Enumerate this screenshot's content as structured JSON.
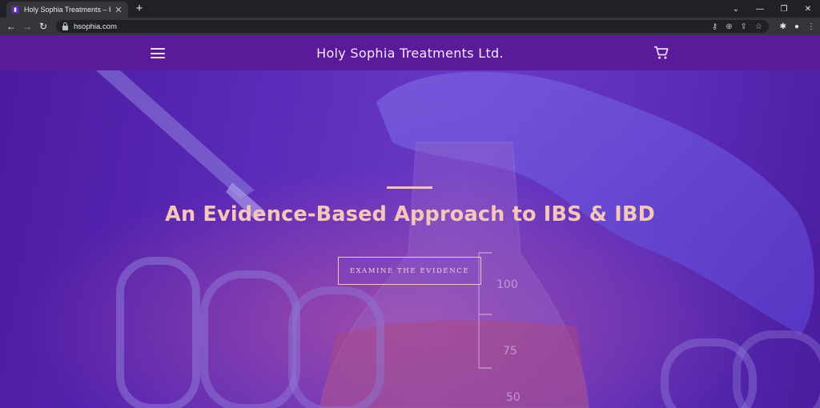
{
  "browser": {
    "tab_title": "Holy Sophia Treatments – Holy S",
    "tab_close": "✕",
    "new_tab": "+",
    "url": "hsophia.com",
    "win_minimize": "⌄",
    "win_restore": "—",
    "win_max": "❐",
    "win_close": "✕",
    "back": "←",
    "forward": "→",
    "reload": "↻"
  },
  "site": {
    "brand": "Holy Sophia Treatments Ltd.",
    "hero": {
      "title": "An Evidence-Based Approach to IBS & IBD",
      "cta_label": "EXAMINE THE EVIDENCE"
    },
    "beaker_marks": [
      "100",
      "75",
      "50"
    ]
  },
  "colors": {
    "header_bg": "#5a1a9a",
    "hero_overlay": "#5a2ab8",
    "accent_text": "#f6c8b4"
  }
}
